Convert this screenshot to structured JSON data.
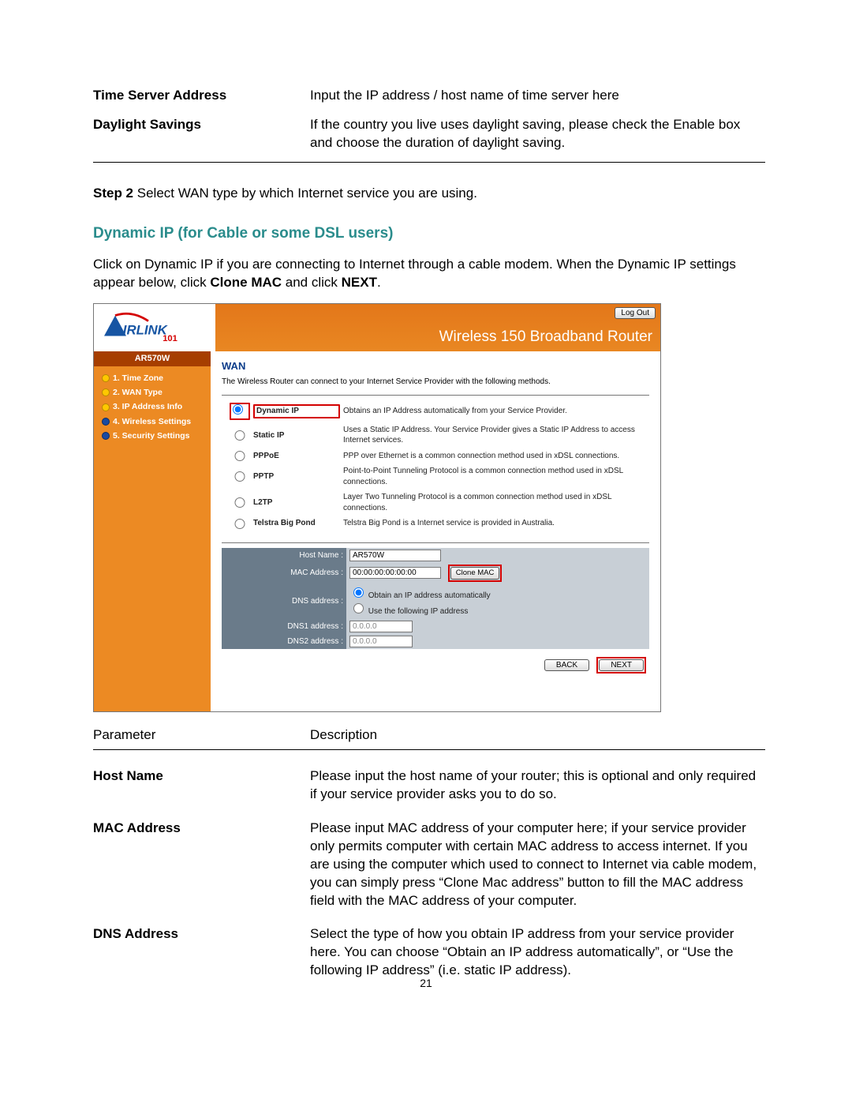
{
  "top_params": {
    "rows": [
      {
        "label": "Time Server Address",
        "desc": "Input the IP address / host name of time server here"
      },
      {
        "label": "Daylight Savings",
        "desc": "If the country you live uses daylight saving, please check the Enable box and choose the duration of daylight saving."
      }
    ]
  },
  "step2": {
    "label": "Step 2",
    "text": " Select WAN type by which Internet service you are using."
  },
  "dynamic_title": "Dynamic IP (for Cable or some DSL users)",
  "dynamic_para_pre": "Click on Dynamic IP if you are connecting to Internet through a cable modem. When the Dynamic IP settings appear below, click ",
  "dynamic_para_b1": "Clone MAC",
  "dynamic_para_mid": " and click ",
  "dynamic_para_b2": "NEXT",
  "dynamic_para_end": ".",
  "router": {
    "banner_title": "Wireless 150 Broadband Router",
    "logout": "Log Out",
    "model": "AR570W",
    "nav": [
      {
        "label": "1. Time Zone",
        "done": true
      },
      {
        "label": "2. WAN Type",
        "done": true
      },
      {
        "label": "3. IP Address Info",
        "done": true
      },
      {
        "label": "4. Wireless Settings",
        "done": false
      },
      {
        "label": "5. Security Settings",
        "done": false
      }
    ],
    "wan_heading": "WAN",
    "wan_intro": "The Wireless Router can connect to your Internet Service Provider with the following methods.",
    "options": [
      {
        "name": "Dynamic IP",
        "desc": "Obtains an IP Address automatically from your Service Provider.",
        "highlight": true,
        "checked": true
      },
      {
        "name": "Static IP",
        "desc": "Uses a Static IP Address. Your Service Provider gives a Static IP Address to access Internet services.",
        "highlight": false,
        "checked": false
      },
      {
        "name": "PPPoE",
        "desc": "PPP over Ethernet is a common connection method used in xDSL connections.",
        "highlight": false,
        "checked": false
      },
      {
        "name": "PPTP",
        "desc": "Point-to-Point Tunneling Protocol is a common connection method used in xDSL connections.",
        "highlight": false,
        "checked": false
      },
      {
        "name": "L2TP",
        "desc": "Layer Two Tunneling Protocol is a common connection method used in xDSL connections.",
        "highlight": false,
        "checked": false
      },
      {
        "name": "Telstra Big Pond",
        "desc": "Telstra Big Pond is a Internet service is provided in Australia.",
        "highlight": false,
        "checked": false
      }
    ],
    "cfg": {
      "host_label": "Host Name :",
      "host_value": "AR570W",
      "mac_label": "MAC Address :",
      "mac_value": "00:00:00:00:00:00",
      "clone_label": "Clone MAC",
      "dns_label": "DNS address :",
      "dns_opt1": "Obtain an IP address automatically",
      "dns_opt2": "Use the following IP address",
      "dns1_label": "DNS1 address :",
      "dns1_value": "0.0.0.0",
      "dns2_label": "DNS2 address :",
      "dns2_value": "0.0.0.0"
    },
    "btn_back": "BACK",
    "btn_next": "NEXT"
  },
  "desc_header": {
    "param": "Parameter",
    "desc": "Description"
  },
  "bottom_params": {
    "rows": [
      {
        "label": "Host Name",
        "desc": "Please input the host name of your router; this is optional and only required if your service provider asks you to do so."
      },
      {
        "label": "MAC Address",
        "desc": "Please input MAC address of your computer here; if your service provider only permits computer with certain MAC address to access internet. If you are using the computer which used to connect to Internet via cable modem, you can simply press “Clone Mac address” button to fill the MAC address field with the MAC address of your computer."
      },
      {
        "label": "DNS Address",
        "desc": "Select the type of how you obtain IP address from your service provider here. You can choose “Obtain an IP address automatically”, or “Use the following IP address” (i.e. static IP address)."
      }
    ]
  },
  "page_number": "21"
}
